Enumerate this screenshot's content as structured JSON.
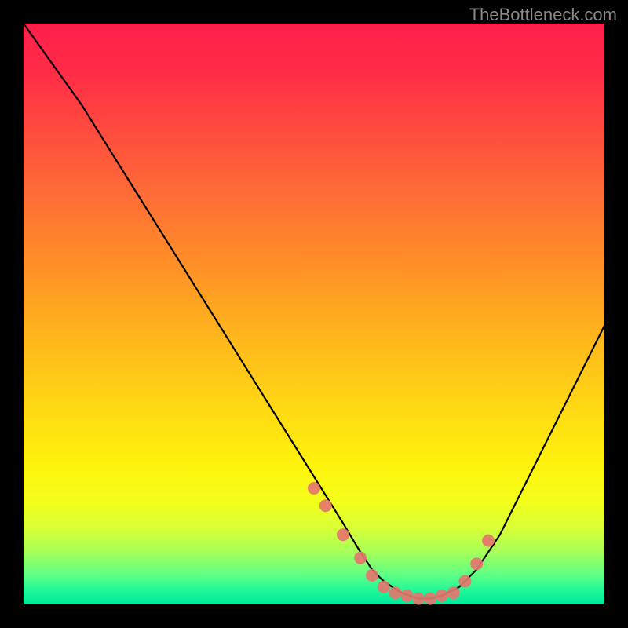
{
  "watermark": "TheBottleneck.com",
  "chart_data": {
    "type": "line",
    "title": "",
    "xlabel": "",
    "ylabel": "",
    "xlim": [
      0,
      100
    ],
    "ylim": [
      0,
      100
    ],
    "series": [
      {
        "name": "bottleneck-curve",
        "x": [
          0,
          5,
          10,
          15,
          20,
          25,
          30,
          35,
          40,
          45,
          50,
          55,
          58,
          60,
          62,
          65,
          68,
          70,
          72,
          75,
          78,
          82,
          86,
          90,
          95,
          100
        ],
        "y": [
          100,
          93,
          86,
          78,
          70,
          62,
          54,
          46,
          38,
          30,
          22,
          14,
          9,
          6,
          4,
          2,
          1,
          1,
          1.5,
          3,
          6,
          12,
          20,
          28,
          38,
          48
        ]
      }
    ],
    "scatter_points": {
      "name": "sample-dots",
      "x": [
        50,
        52,
        55,
        58,
        60,
        62,
        64,
        66,
        68,
        70,
        72,
        74,
        76,
        78,
        80
      ],
      "y": [
        20,
        17,
        12,
        8,
        5,
        3,
        2,
        1.5,
        1,
        1,
        1.5,
        2,
        4,
        7,
        11
      ]
    },
    "gradient_stops": [
      {
        "pos": 0,
        "color": "#ff1f4a"
      },
      {
        "pos": 50,
        "color": "#ffd814"
      },
      {
        "pos": 100,
        "color": "#00e79b"
      }
    ]
  }
}
